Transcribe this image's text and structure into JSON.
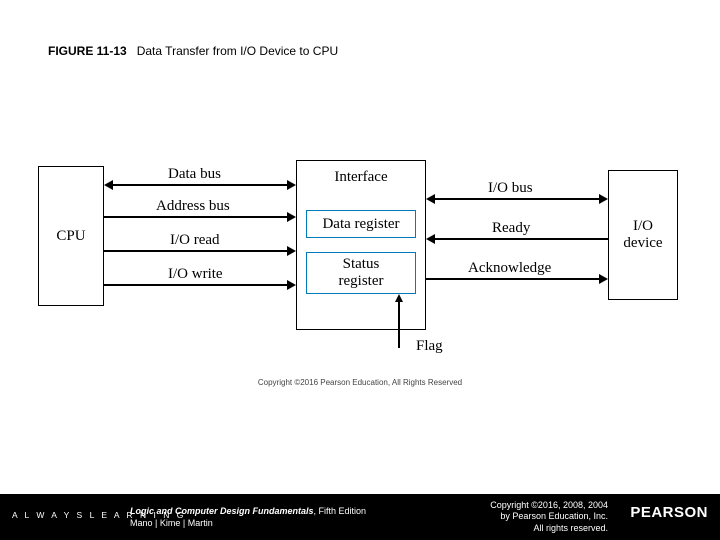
{
  "caption": {
    "fignum": "FIGURE 11-13",
    "title": "Data Transfer from I/O Device to CPU"
  },
  "blocks": {
    "cpu": "CPU",
    "interface": "Interface",
    "data_register": "Data register",
    "status_register": "Status\nregister",
    "io_device": "I/O\ndevice"
  },
  "signals": {
    "data_bus": "Data bus",
    "address_bus": "Address bus",
    "io_read": "I/O read",
    "io_write": "I/O write",
    "io_bus": "I/O bus",
    "ready": "Ready",
    "acknowledge": "Acknowledge",
    "flag": "Flag"
  },
  "copy_inline": "Copyright ©2016 Pearson Education, All Rights Reserved",
  "footer": {
    "always": "A L W A Y S  L E A R N I N G",
    "book_title": "Logic and Computer Design Fundamentals",
    "book_edition": ", Fifth Edition",
    "authors": "Mano | Kime | Martin",
    "rights": "Copyright ©2016, 2008, 2004\nby Pearson Education, Inc.\nAll rights reserved.",
    "brand": "PEARSON"
  }
}
